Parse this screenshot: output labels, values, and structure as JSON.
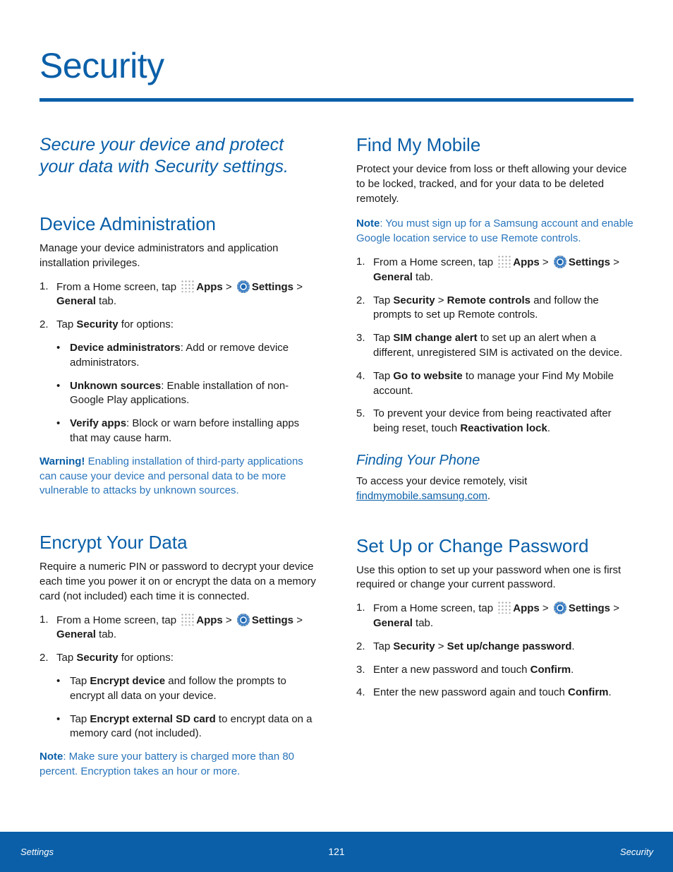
{
  "page": {
    "title": "Security",
    "tagline": "Secure your device and protect your data with Security settings."
  },
  "common": {
    "step_home_prefix": "From a Home screen, tap",
    "apps": "Apps",
    "gt": ">",
    "settings": "Settings",
    "general": "General",
    "tab": "tab.",
    "tap": "Tap",
    "security": "Security",
    "apps_icon": "apps-grid-icon",
    "settings_icon": "settings-gear-icon"
  },
  "device_admin": {
    "heading": "Device Administration",
    "intro": "Manage your device administrators and application installation privileges.",
    "step2_suffix": "for options:",
    "bullets": [
      {
        "bold": "Device administrators",
        "text": ": Add or remove device administrators."
      },
      {
        "bold": "Unknown sources",
        "text": ": Enable installation of non-Google Play applications."
      },
      {
        "bold": "Verify apps",
        "text": ": Block or warn before installing apps that may cause harm."
      }
    ],
    "warning_label": "Warning!",
    "warning_text": " Enabling installation of third-party applications can cause your device and personal data to be more vulnerable to attacks by unknown sources."
  },
  "encrypt": {
    "heading": "Encrypt Your Data",
    "intro": "Require a numeric PIN or password to decrypt your device each time you power it on or encrypt the data on a memory card (not included) each time it is connected.",
    "step2_suffix": "for options:",
    "bullets": [
      {
        "pre": "Tap ",
        "bold": "Encrypt device",
        "text": " and follow the prompts to encrypt all data on your device."
      },
      {
        "pre": "Tap ",
        "bold": "Encrypt external SD card",
        "text": " to encrypt data on a memory card (not included)."
      }
    ],
    "note_label": "Note",
    "note_text": ": Make sure your battery is charged more than 80 percent. Encryption takes an hour or more."
  },
  "find_my_mobile": {
    "heading": "Find My Mobile",
    "intro": "Protect your device from loss or theft allowing your device to be locked, tracked, and for your data to be deleted remotely.",
    "note_label": "Note",
    "note_text": ": You must sign up for a Samsung account and enable Google location service to use Remote controls.",
    "steps": [
      {
        "num": "2.",
        "pre": "Tap ",
        "b1": "Security",
        "mid": " > ",
        "b2": "Remote controls",
        "post": " and follow the prompts to set up Remote controls."
      },
      {
        "num": "3.",
        "pre": "Tap ",
        "b1": "SIM change alert",
        "mid": " to set up an alert when a different, unregistered SIM is activated on the device.",
        "b2": "",
        "post": ""
      },
      {
        "num": "4.",
        "pre": "Tap ",
        "b1": "Go to website",
        "mid": " to manage your Find My Mobile account.",
        "b2": "",
        "post": ""
      },
      {
        "num": "5.",
        "pre": "To prevent your device from being reactivated after being reset, touch ",
        "b1": "Reactivation lock",
        "mid": ".",
        "b2": "",
        "post": ""
      }
    ],
    "subheading": "Finding Your Phone",
    "finding_text": "To access your device remotely, visit",
    "finding_link": "findmymobile.samsung.com",
    "finding_end": "."
  },
  "password": {
    "heading": "Set Up or Change Password",
    "intro": "Use this option to set up your password when one is first required or change your current password.",
    "steps": [
      {
        "num": "2.",
        "pre": "Tap ",
        "b1": "Security",
        "mid": " > ",
        "b2": "Set up/change password",
        "post": "."
      },
      {
        "num": "3.",
        "pre": "Enter a new password and touch ",
        "b1": "Confirm",
        "mid": ".",
        "b2": "",
        "post": ""
      },
      {
        "num": "4.",
        "pre": "Enter the new password again and touch ",
        "b1": "Confirm",
        "mid": ".",
        "b2": "",
        "post": ""
      }
    ]
  },
  "footer": {
    "left": "Settings",
    "page_number": "121",
    "right": "Security"
  }
}
